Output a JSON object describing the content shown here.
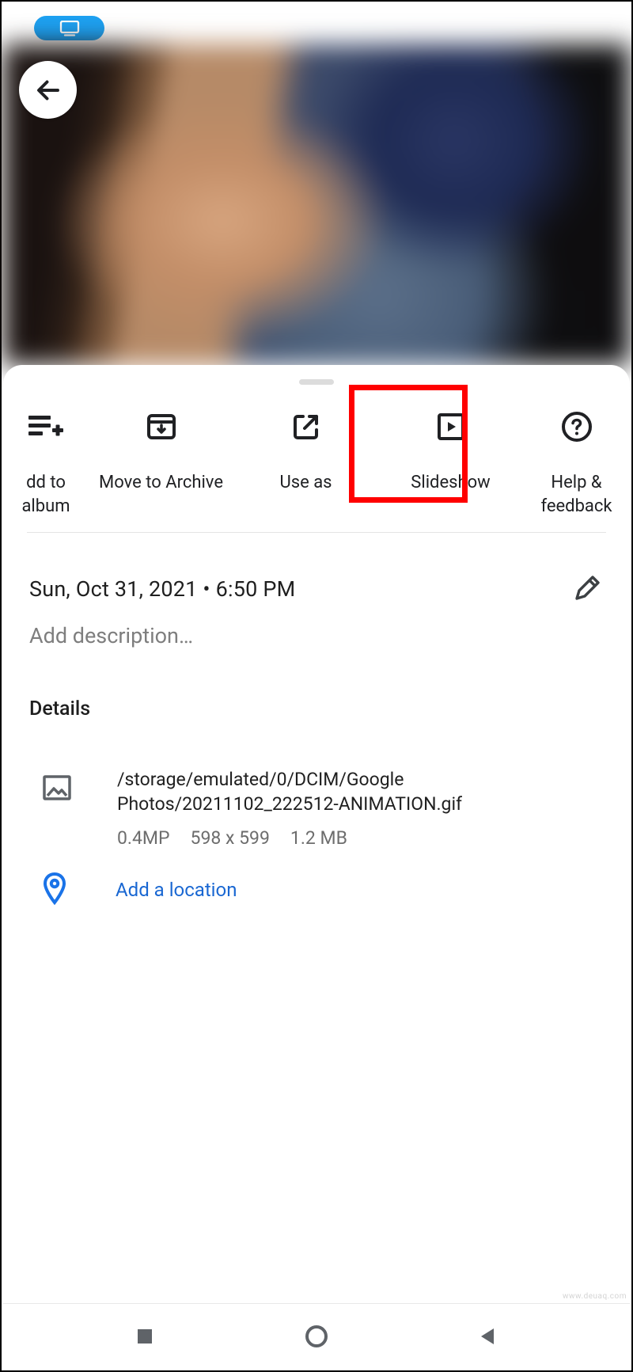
{
  "actions": [
    {
      "key": "add-to-album",
      "label": "dd to album"
    },
    {
      "key": "move-to-archive",
      "label": "Move to Archive"
    },
    {
      "key": "use-as",
      "label": "Use as"
    },
    {
      "key": "slideshow",
      "label": "Slideshow"
    },
    {
      "key": "help-feedback",
      "label": "Help &\nfeedback"
    }
  ],
  "highlighted_action": "slideshow",
  "datetime": "Sun, Oct 31, 2021  •  6:50 PM",
  "description_placeholder": "Add description…",
  "details_title": "Details",
  "file": {
    "path": "/storage/emulated/0/DCIM/Google Photos/20211102_222512-ANIMATION.gif",
    "megapixels": "0.4MP",
    "dimensions": "598 x 599",
    "size": "1.2 MB"
  },
  "location_action": "Add a location",
  "watermark": "www.deuaq.com",
  "colors": {
    "accent": "#1a73e8",
    "highlight": "#ff0000",
    "pill": "#1da1f2"
  }
}
